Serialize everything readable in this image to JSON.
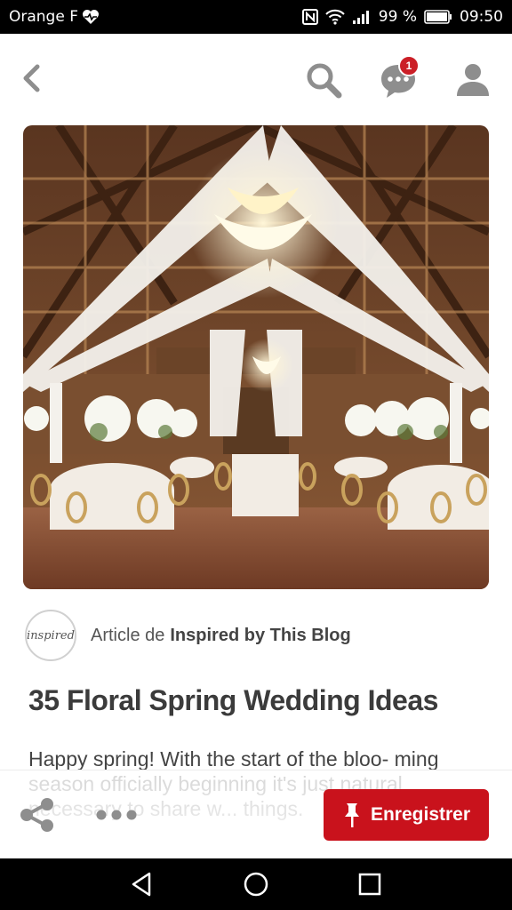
{
  "status_bar": {
    "carrier": "Orange F",
    "battery": "99 %",
    "time": "09:50"
  },
  "header": {
    "notification_count": "1"
  },
  "pin": {
    "source_prefix": "Article de",
    "source_name": "Inspired by This Blog",
    "avatar_text": "inspired",
    "title": "35 Floral Spring Wedding Ideas",
    "description": "Happy spring! With the start of the bloo- ming season officially beginning it's just natural necessary to share w... things."
  },
  "actions": {
    "save_label": "Enregistrer"
  },
  "colors": {
    "accent": "#c9121c",
    "badge": "#cb1f27"
  },
  "icons": {
    "back": "chevron-left-icon",
    "search": "search-icon",
    "messages": "chat-bubble-icon",
    "profile": "person-icon",
    "expand": "expand-icon",
    "share": "share-icon",
    "more": "more-dots-icon",
    "pin": "pushpin-icon"
  }
}
